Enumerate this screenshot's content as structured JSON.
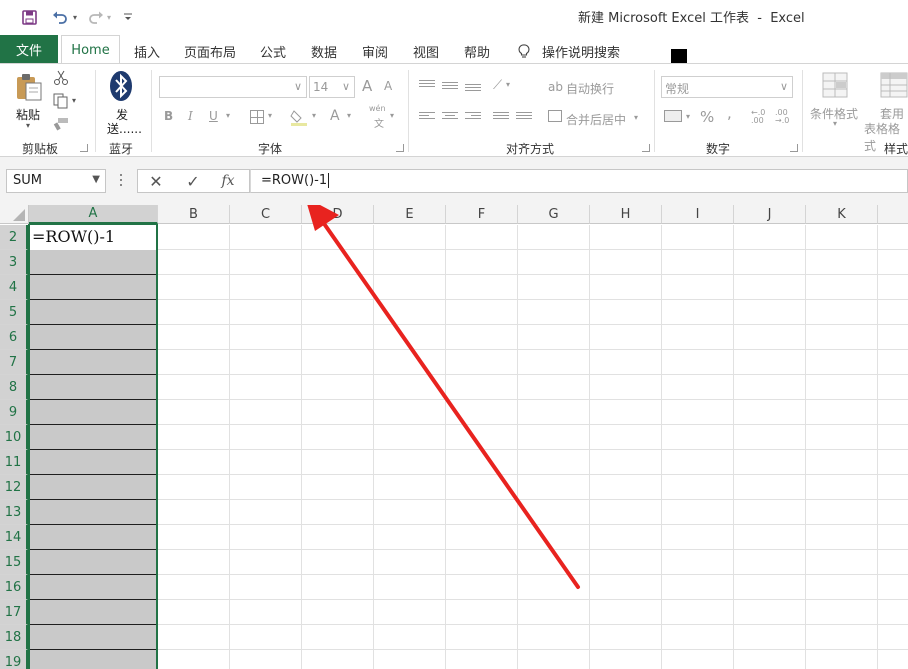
{
  "app": {
    "window_title": "新建 Microsoft Excel 工作表  -  Excel"
  },
  "tabs": {
    "file": "文件",
    "items": [
      "Home",
      "插入",
      "页面布局",
      "公式",
      "数据",
      "审阅",
      "视图",
      "帮助"
    ],
    "active": "Home",
    "tell_me": "操作说明搜索"
  },
  "ribbon": {
    "clipboard": {
      "paste": "粘贴",
      "label": "剪贴板"
    },
    "bluetooth": {
      "send": "发",
      "send2": "送......",
      "label": "蓝牙"
    },
    "font": {
      "size": "14",
      "bold": "B",
      "italic": "I",
      "underline": "U",
      "grow": "A",
      "shrink": "A",
      "font_color": "A",
      "phonetic_top": "wén",
      "phonetic_bottom": "文",
      "label": "字体"
    },
    "alignment": {
      "wrap": "自动换行",
      "merge": "合并后居中",
      "label": "对齐方式"
    },
    "number": {
      "format": "常规",
      "percent": "%",
      "comma": ",",
      "inc": "←.0 .00",
      "dec": ".00 →.0",
      "label": "数字"
    },
    "styles": {
      "conditional": "条件格式",
      "table_line1": "套用",
      "table_line2": "表格格式",
      "label": "样式"
    }
  },
  "formula_bar": {
    "name_box": "SUM",
    "cancel": "✕",
    "enter": "✓",
    "fx": "fx",
    "formula": "=ROW()-1"
  },
  "grid": {
    "columns": [
      "A",
      "B",
      "C",
      "D",
      "E",
      "F",
      "G",
      "H",
      "I",
      "J",
      "K"
    ],
    "rows": [
      "2",
      "3",
      "4",
      "5",
      "6",
      "7",
      "8",
      "9",
      "10",
      "11",
      "12",
      "13",
      "14",
      "15",
      "16",
      "17",
      "18",
      "19"
    ],
    "active_cell_text": "=ROW()-1"
  },
  "colors": {
    "excel_green": "#217346",
    "selection_gray": "#c9c9c9",
    "arrow_red": "#e8231f"
  }
}
